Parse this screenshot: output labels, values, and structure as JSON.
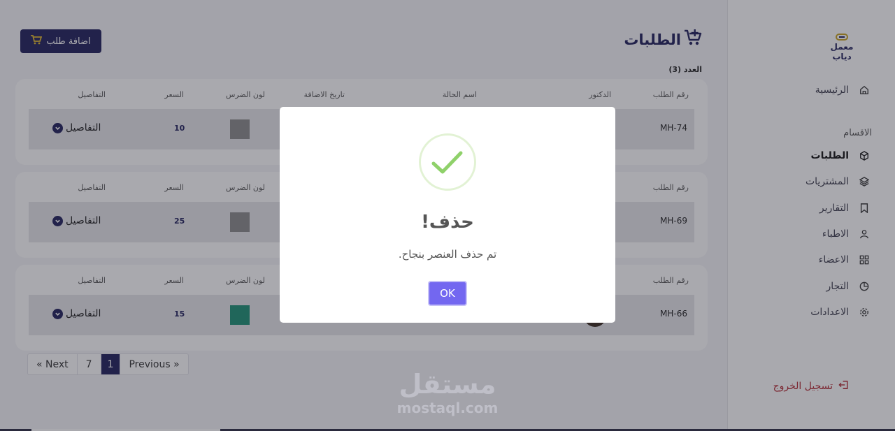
{
  "sidebar": {
    "logo_text": "معمل دياب",
    "home": "الرئيسية",
    "section_label": "الاقسام",
    "items": [
      {
        "label": "الطلبات",
        "icon": "cube-icon"
      },
      {
        "label": "المشتريات",
        "icon": "layers-icon"
      },
      {
        "label": "التقارير",
        "icon": "bookmark-icon"
      },
      {
        "label": "الاطباء",
        "icon": "user-icon"
      },
      {
        "label": "الاعضاء",
        "icon": "grid-icon"
      },
      {
        "label": "التجار",
        "icon": "pie-chart-icon"
      },
      {
        "label": "الاعدادات",
        "icon": "settings-icon"
      }
    ],
    "logout": "تسجيل الخروج"
  },
  "header": {
    "title": "الطلبات",
    "count": "العدد (3)",
    "add_button": "اضافة طلب"
  },
  "table": {
    "columns": [
      "رقم الطلب",
      "الدكتور",
      "اسم الحالة",
      "تاريخ الاضافة",
      "لون الضرس",
      "السعر",
      "التفاصيل"
    ],
    "rows": [
      {
        "id": "MH-74",
        "price": "10",
        "color": "#8a8a8a",
        "details": "التفاصيل"
      },
      {
        "id": "MH-69",
        "price": "25",
        "color": "#8a8a8a",
        "details": "التفاصيل"
      },
      {
        "id": "MH-66",
        "price": "15",
        "color": "#1b8f73",
        "details": "التفاصيل"
      }
    ]
  },
  "pagination": {
    "next": "« Next",
    "pages": [
      "7",
      "1"
    ],
    "previous": "Previous »"
  },
  "watermark": {
    "arabic": "مستقل",
    "english": "mostaql.com"
  },
  "modal": {
    "title": "حذف!",
    "message": "تم حذف العنصر بنجاح.",
    "ok": "OK"
  },
  "colors": {
    "brand": "#1f1f5a",
    "accent": "#7367f0",
    "success": "#8fd16a",
    "danger": "#b3262f"
  }
}
